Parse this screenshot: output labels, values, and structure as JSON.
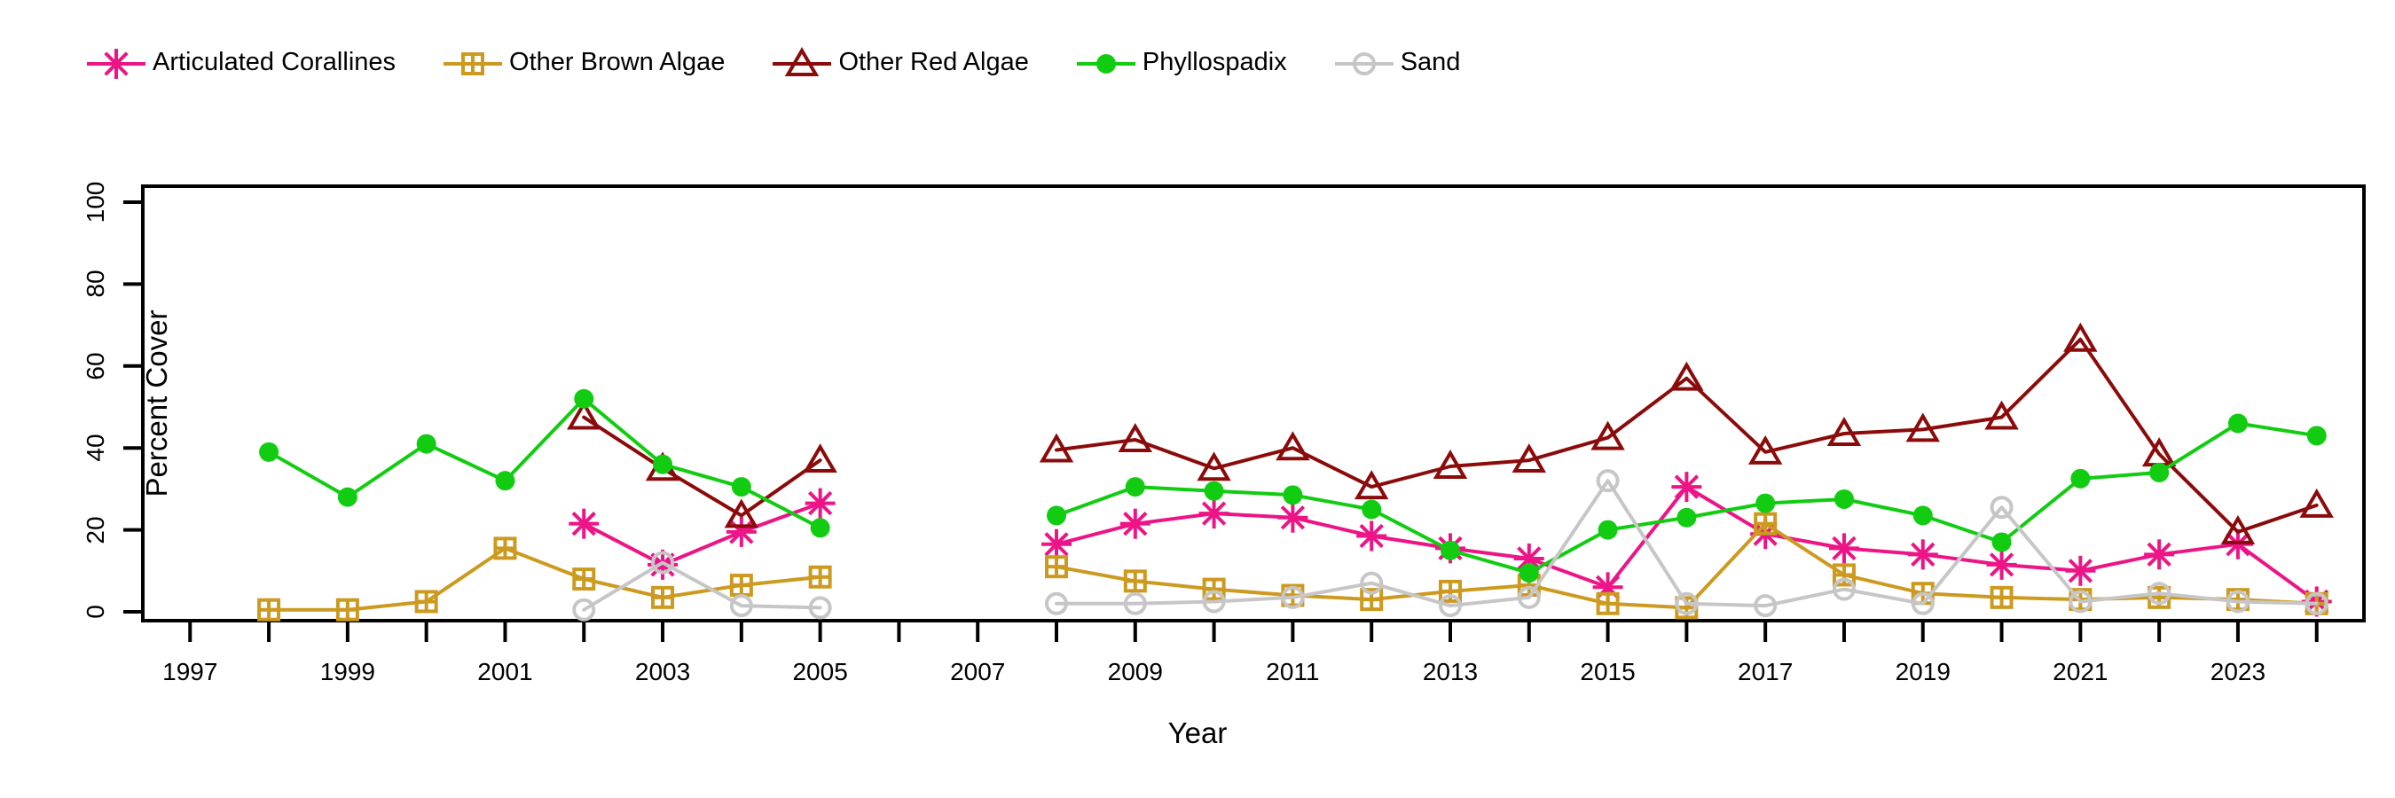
{
  "chart_data": {
    "type": "line",
    "title": "",
    "xlabel": "Year",
    "ylabel": "Percent Cover",
    "xlim": [
      1996.4,
      2024.6
    ],
    "ylim": [
      0,
      100
    ],
    "yticks": [
      0,
      20,
      40,
      60,
      80,
      100
    ],
    "xticks": [
      1997,
      1998,
      1999,
      2000,
      2001,
      2002,
      2003,
      2004,
      2005,
      2006,
      2007,
      2008,
      2009,
      2010,
      2011,
      2012,
      2013,
      2014,
      2015,
      2016,
      2017,
      2018,
      2019,
      2020,
      2021,
      2022,
      2023,
      2024
    ],
    "xtick_labels": [
      "1997",
      "",
      "1999",
      "",
      "2001",
      "",
      "2003",
      "",
      "2005",
      "",
      "2007",
      "",
      "2009",
      "",
      "2011",
      "",
      "2013",
      "",
      "2015",
      "",
      "2017",
      "",
      "2019",
      "",
      "2021",
      "",
      "2023",
      ""
    ],
    "grid": false,
    "legend_position": "top",
    "series": [
      {
        "name": "Articulated Corallines",
        "color": "#EC1486",
        "marker": "asterisk",
        "x": [
          2002,
          2003,
          2004,
          2005,
          2008,
          2009,
          2010,
          2011,
          2012,
          2013,
          2014,
          2015,
          2016,
          2017,
          2018,
          2019,
          2020,
          2021,
          2022,
          2023,
          2024
        ],
        "y": [
          21.5,
          11.5,
          19.5,
          26.5,
          16.5,
          21.5,
          24.0,
          23.0,
          18.5,
          15.5,
          13.0,
          6.0,
          30.5,
          19.0,
          15.5,
          14.0,
          11.5,
          10.0,
          14.0,
          16.5,
          2.5
        ],
        "values_detail": [
          {
            "year": 2002,
            "value": 21.5
          },
          {
            "year": 2003,
            "value": 11.5
          },
          {
            "year": 2004,
            "value": 19.5
          },
          {
            "year": 2005,
            "value": 26.5
          },
          {
            "year": 2008,
            "value": 16.5
          },
          {
            "year": 2009,
            "value": 21.5
          },
          {
            "year": 2010,
            "value": 24.0
          },
          {
            "year": 2011,
            "value": 23.0
          },
          {
            "year": 2012,
            "value": 18.5
          },
          {
            "year": 2013,
            "value": 15.5
          },
          {
            "year": 2014,
            "value": 13.0
          },
          {
            "year": 2015,
            "value": 6.0
          },
          {
            "year": 2016,
            "value": 30.5
          },
          {
            "year": 2017,
            "value": 19.0
          },
          {
            "year": 2018,
            "value": 15.5
          },
          {
            "year": 2019,
            "value": 14.0
          },
          {
            "year": 2020,
            "value": 11.5
          },
          {
            "year": 2021,
            "value": 10.0
          },
          {
            "year": 2022,
            "value": 14.0
          },
          {
            "year": 2023,
            "value": 16.5
          },
          {
            "year": 2024,
            "value": 2.5
          }
        ]
      },
      {
        "name": "Other Brown Algae",
        "color": "#CC9A1F",
        "marker": "square-plus",
        "x": [
          1998,
          1999,
          2000,
          2001,
          2002,
          2003,
          2004,
          2005,
          2008,
          2009,
          2010,
          2011,
          2012,
          2013,
          2014,
          2015,
          2016,
          2017,
          2018,
          2019,
          2020,
          2021,
          2022,
          2023,
          2024
        ],
        "y": [
          0.5,
          0.5,
          2.5,
          15.5,
          8.0,
          3.5,
          6.5,
          8.5,
          11.0,
          7.5,
          5.5,
          4.0,
          3.0,
          5.0,
          6.5,
          2.0,
          1.0,
          21.5,
          9.0,
          4.5,
          3.5,
          3.0,
          3.5,
          3.0,
          2.0
        ],
        "values_detail": [
          {
            "year": 1998,
            "value": 0.5
          },
          {
            "year": 1999,
            "value": 0.5
          },
          {
            "year": 2000,
            "value": 2.5
          },
          {
            "year": 2001,
            "value": 15.5
          },
          {
            "year": 2002,
            "value": 8.0
          },
          {
            "year": 2003,
            "value": 3.5
          },
          {
            "year": 2004,
            "value": 6.5
          },
          {
            "year": 2005,
            "value": 8.5
          },
          {
            "year": 2008,
            "value": 11.0
          },
          {
            "year": 2009,
            "value": 7.5
          },
          {
            "year": 2010,
            "value": 5.5
          },
          {
            "year": 2011,
            "value": 4.0
          },
          {
            "year": 2012,
            "value": 3.0
          },
          {
            "year": 2013,
            "value": 5.0
          },
          {
            "year": 2014,
            "value": 6.5
          },
          {
            "year": 2015,
            "value": 2.0
          },
          {
            "year": 2016,
            "value": 1.0
          },
          {
            "year": 2017,
            "value": 21.5
          },
          {
            "year": 2018,
            "value": 9.0
          },
          {
            "year": 2019,
            "value": 4.5
          },
          {
            "year": 2020,
            "value": 3.5
          },
          {
            "year": 2021,
            "value": 3.0
          },
          {
            "year": 2022,
            "value": 3.5
          },
          {
            "year": 2023,
            "value": 3.0
          },
          {
            "year": 2024,
            "value": 2.0
          }
        ]
      },
      {
        "name": "Other Red Algae",
        "color": "#8B0B0B",
        "marker": "triangle",
        "x": [
          2002,
          2003,
          2004,
          2005,
          2008,
          2009,
          2010,
          2011,
          2012,
          2013,
          2014,
          2015,
          2016,
          2017,
          2018,
          2019,
          2020,
          2021,
          2022,
          2023,
          2024
        ],
        "y": [
          47.5,
          35.0,
          23.5,
          37.0,
          39.5,
          42.0,
          35.0,
          40.0,
          30.5,
          35.5,
          37.0,
          42.5,
          57.0,
          39.0,
          43.5,
          44.5,
          47.5,
          66.5,
          38.5,
          19.5,
          26.0
        ],
        "values_detail": [
          {
            "year": 2002,
            "value": 47.5
          },
          {
            "year": 2003,
            "value": 35.0
          },
          {
            "year": 2004,
            "value": 23.5
          },
          {
            "year": 2005,
            "value": 37.0
          },
          {
            "year": 2008,
            "value": 39.5
          },
          {
            "year": 2009,
            "value": 42.0
          },
          {
            "year": 2010,
            "value": 35.0
          },
          {
            "year": 2011,
            "value": 40.0
          },
          {
            "year": 2012,
            "value": 30.5
          },
          {
            "year": 2013,
            "value": 35.5
          },
          {
            "year": 2014,
            "value": 37.0
          },
          {
            "year": 2015,
            "value": 42.5
          },
          {
            "year": 2016,
            "value": 57.0
          },
          {
            "year": 2017,
            "value": 39.0
          },
          {
            "year": 2018,
            "value": 43.5
          },
          {
            "year": 2019,
            "value": 44.5
          },
          {
            "year": 2020,
            "value": 47.5
          },
          {
            "year": 2021,
            "value": 66.5
          },
          {
            "year": 2022,
            "value": 38.5
          },
          {
            "year": 2023,
            "value": 19.5
          },
          {
            "year": 2024,
            "value": 26.0
          }
        ]
      },
      {
        "name": "Phyllospadix",
        "color": "#11CC11",
        "marker": "circle-filled",
        "x": [
          1998,
          1999,
          2000,
          2001,
          2002,
          2003,
          2004,
          2005,
          2008,
          2009,
          2010,
          2011,
          2012,
          2013,
          2014,
          2015,
          2016,
          2017,
          2018,
          2019,
          2020,
          2021,
          2022,
          2023,
          2024
        ],
        "y": [
          39.0,
          28.0,
          41.0,
          32.0,
          52.0,
          36.0,
          30.5,
          20.5,
          23.5,
          30.5,
          29.5,
          28.5,
          25.0,
          15.0,
          9.5,
          20.0,
          23.0,
          26.5,
          27.5,
          23.5,
          17.0,
          32.5,
          34.0,
          46.0,
          43.0
        ],
        "values_detail": [
          {
            "year": 1998,
            "value": 39.0
          },
          {
            "year": 1999,
            "value": 28.0
          },
          {
            "year": 2000,
            "value": 41.0
          },
          {
            "year": 2001,
            "value": 32.0
          },
          {
            "year": 2002,
            "value": 52.0
          },
          {
            "year": 2003,
            "value": 36.0
          },
          {
            "year": 2004,
            "value": 30.5
          },
          {
            "year": 2005,
            "value": 20.5
          },
          {
            "year": 2008,
            "value": 23.5
          },
          {
            "year": 2009,
            "value": 30.5
          },
          {
            "year": 2010,
            "value": 29.5
          },
          {
            "year": 2011,
            "value": 28.5
          },
          {
            "year": 2012,
            "value": 25.0
          },
          {
            "year": 2013,
            "value": 15.0
          },
          {
            "year": 2014,
            "value": 9.5
          },
          {
            "year": 2015,
            "value": 20.0
          },
          {
            "year": 2016,
            "value": 23.0
          },
          {
            "year": 2017,
            "value": 26.5
          },
          {
            "year": 2018,
            "value": 27.5
          },
          {
            "year": 2019,
            "value": 23.5
          },
          {
            "year": 2020,
            "value": 17.0
          },
          {
            "year": 2021,
            "value": 32.5
          },
          {
            "year": 2022,
            "value": 34.0
          },
          {
            "year": 2023,
            "value": 46.0
          },
          {
            "year": 2024,
            "value": 43.0
          }
        ]
      },
      {
        "name": "Sand",
        "color": "#C6C6C6",
        "marker": "circle-open",
        "x": [
          2002,
          2003,
          2004,
          2005,
          2008,
          2009,
          2010,
          2011,
          2012,
          2013,
          2014,
          2015,
          2016,
          2017,
          2018,
          2019,
          2020,
          2021,
          2022,
          2023,
          2024
        ],
        "y": [
          0.5,
          12.0,
          1.5,
          1.0,
          2.0,
          2.0,
          2.5,
          3.5,
          7.0,
          1.5,
          3.5,
          32.0,
          2.0,
          1.5,
          5.5,
          2.0,
          25.5,
          2.5,
          4.5,
          2.5,
          2.0
        ],
        "values_detail": [
          {
            "year": 2002,
            "value": 0.5
          },
          {
            "year": 2003,
            "value": 12.0
          },
          {
            "year": 2004,
            "value": 1.5
          },
          {
            "year": 2005,
            "value": 1.0
          },
          {
            "year": 2008,
            "value": 2.0
          },
          {
            "year": 2009,
            "value": 2.0
          },
          {
            "year": 2010,
            "value": 2.5
          },
          {
            "year": 2011,
            "value": 3.5
          },
          {
            "year": 2012,
            "value": 7.0
          },
          {
            "year": 2013,
            "value": 1.5
          },
          {
            "year": 2014,
            "value": 3.5
          },
          {
            "year": 2015,
            "value": 32.0
          },
          {
            "year": 2016,
            "value": 2.0
          },
          {
            "year": 2017,
            "value": 1.5
          },
          {
            "year": 2018,
            "value": 5.5
          },
          {
            "year": 2019,
            "value": 2.0
          },
          {
            "year": 2020,
            "value": 25.5
          },
          {
            "year": 2021,
            "value": 2.5
          },
          {
            "year": 2022,
            "value": 4.5
          },
          {
            "year": 2023,
            "value": 2.5
          },
          {
            "year": 2024,
            "value": 2.0
          }
        ]
      }
    ]
  },
  "legend": {
    "items": [
      {
        "label": "Articulated Corallines"
      },
      {
        "label": "Other Brown Algae"
      },
      {
        "label": "Other Red Algae"
      },
      {
        "label": "Phyllospadix"
      },
      {
        "label": "Sand"
      }
    ]
  },
  "axes": {
    "y_title": "Percent Cover",
    "x_title": "Year"
  }
}
